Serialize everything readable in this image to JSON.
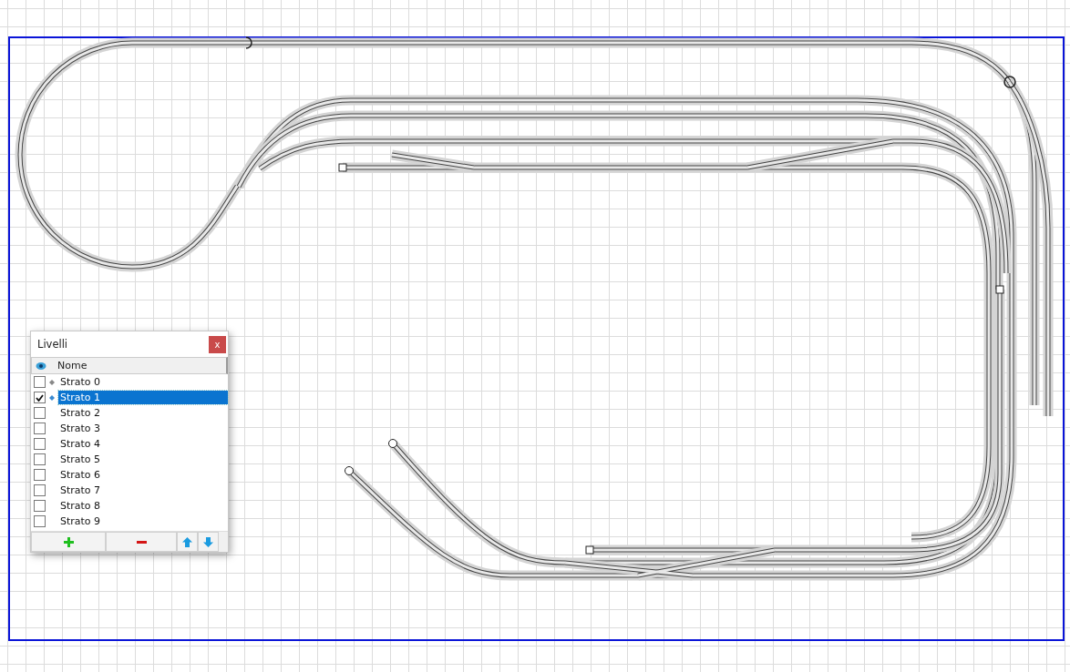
{
  "layers_panel": {
    "title": "Livelli",
    "close": "x",
    "column": "Nome",
    "layers": [
      {
        "name": "Strato 0",
        "checked": false,
        "selected": false,
        "marker": true
      },
      {
        "name": "Strato 1",
        "checked": true,
        "selected": true,
        "marker": true
      },
      {
        "name": "Strato 2",
        "checked": false,
        "selected": false,
        "marker": false
      },
      {
        "name": "Strato 3",
        "checked": false,
        "selected": false,
        "marker": false
      },
      {
        "name": "Strato 4",
        "checked": false,
        "selected": false,
        "marker": false
      },
      {
        "name": "Strato 5",
        "checked": false,
        "selected": false,
        "marker": false
      },
      {
        "name": "Strato 6",
        "checked": false,
        "selected": false,
        "marker": false
      },
      {
        "name": "Strato 7",
        "checked": false,
        "selected": false,
        "marker": false
      },
      {
        "name": "Strato 8",
        "checked": false,
        "selected": false,
        "marker": false
      },
      {
        "name": "Strato 9",
        "checked": false,
        "selected": false,
        "marker": false
      }
    ],
    "buttons": [
      {
        "kind": "add"
      },
      {
        "kind": "remove"
      },
      {
        "kind": "up"
      },
      {
        "kind": "down"
      }
    ]
  }
}
